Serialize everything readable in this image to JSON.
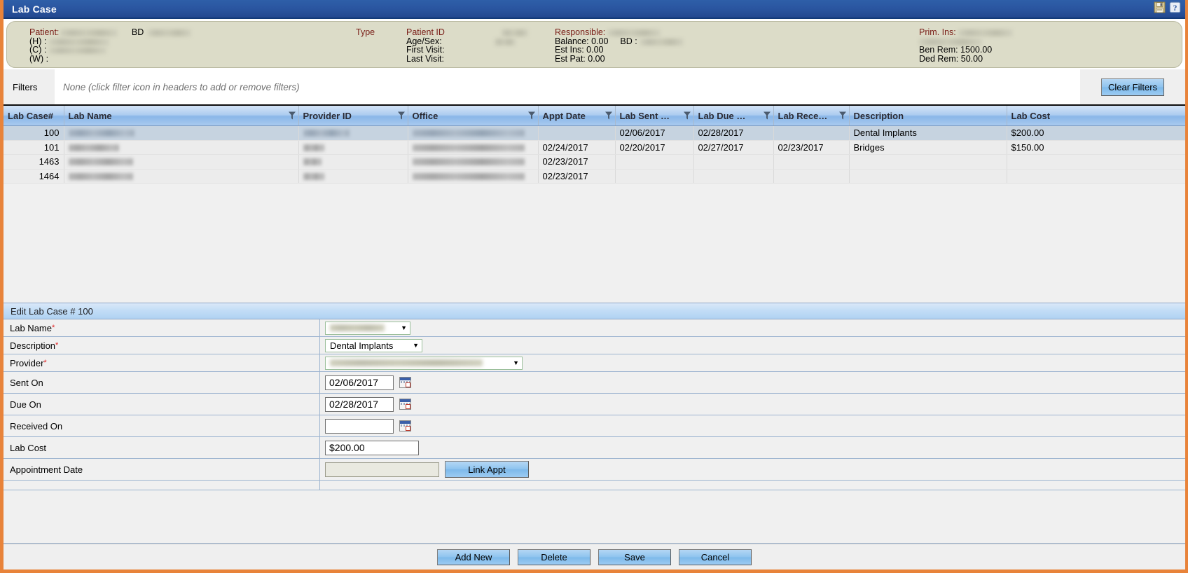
{
  "window": {
    "title": "Lab Case",
    "icons": [
      "save-disk-icon",
      "help-icon"
    ]
  },
  "patient_header": {
    "col1": {
      "patient_label": "Patient:",
      "h_label": "(H) :",
      "c_label": "(C) :",
      "w_label": "(W) :",
      "bd_label": "BD"
    },
    "col2": {
      "type_label": "Type"
    },
    "col3": {
      "patient_id_label": "Patient ID",
      "age_sex_label": "Age/Sex:",
      "first_visit_label": "First Visit:",
      "last_visit_label": "Last Visit:"
    },
    "col4": {
      "responsible_label": "Responsible:",
      "balance_label": "Balance: 0.00",
      "bd_label": "BD :",
      "est_ins_label": "Est Ins:  0.00",
      "est_pat_label": "Est Pat: 0.00"
    },
    "col5": {
      "prim_ins_label": "Prim. Ins:",
      "ben_rem_label": "Ben Rem: 1500.00",
      "ded_rem_label": "Ded Rem: 50.00"
    }
  },
  "filters": {
    "label": "Filters",
    "none_text": "None (click filter icon in headers to add or remove filters)",
    "clear_button": "Clear Filters"
  },
  "grid": {
    "columns": [
      {
        "label": "Lab Case#",
        "filter": false,
        "align": "right"
      },
      {
        "label": "Lab Name",
        "filter": true,
        "align": "left"
      },
      {
        "label": "Provider ID",
        "filter": true,
        "align": "left"
      },
      {
        "label": "Office",
        "filter": true,
        "align": "left"
      },
      {
        "label": "Appt Date",
        "filter": true,
        "align": "left"
      },
      {
        "label": "Lab Sent …",
        "filter": true,
        "align": "left"
      },
      {
        "label": "Lab Due …",
        "filter": true,
        "align": "left"
      },
      {
        "label": "Lab Rece…",
        "filter": true,
        "align": "left"
      },
      {
        "label": "Description",
        "filter": false,
        "align": "left"
      },
      {
        "label": "Lab Cost",
        "filter": false,
        "align": "left"
      }
    ],
    "rows": [
      {
        "selected": true,
        "lab_case": "100",
        "lab_name": "",
        "provider_id": "",
        "office": "",
        "appt_date": "",
        "lab_sent": "02/06/2017",
        "lab_due": "02/28/2017",
        "lab_received": "",
        "description": "Dental Implants",
        "lab_cost": "$200.00"
      },
      {
        "selected": false,
        "lab_case": "101",
        "lab_name": "",
        "provider_id": "",
        "office": "",
        "appt_date": "02/24/2017",
        "lab_sent": "02/20/2017",
        "lab_due": "02/27/2017",
        "lab_received": "02/23/2017",
        "description": "Bridges",
        "lab_cost": "$150.00"
      },
      {
        "selected": false,
        "lab_case": "1463",
        "lab_name": "",
        "provider_id": "",
        "office": "",
        "appt_date": "02/23/2017",
        "lab_sent": "",
        "lab_due": "",
        "lab_received": "",
        "description": "",
        "lab_cost": ""
      },
      {
        "selected": false,
        "lab_case": "1464",
        "lab_name": "",
        "provider_id": "",
        "office": "",
        "appt_date": "02/23/2017",
        "lab_sent": "",
        "lab_due": "",
        "lab_received": "",
        "description": "",
        "lab_cost": ""
      }
    ]
  },
  "edit_panel": {
    "header": "Edit Lab Case # 100",
    "fields": {
      "lab_name_label": "Lab Name",
      "lab_name_value": "",
      "description_label": "Description",
      "description_value": "Dental Implants",
      "provider_label": "Provider",
      "provider_value": "",
      "sent_on_label": "Sent On",
      "sent_on_value": "02/06/2017",
      "due_on_label": "Due On",
      "due_on_value": "02/28/2017",
      "received_on_label": "Received On",
      "received_on_value": "",
      "lab_cost_label": "Lab Cost",
      "lab_cost_value": "$200.00",
      "appointment_date_label": "Appointment Date",
      "appointment_date_value": "",
      "link_appt_button": "Link Appt"
    }
  },
  "footer": {
    "add_new": "Add New",
    "delete": "Delete",
    "save": "Save",
    "cancel": "Cancel"
  },
  "colors": {
    "titlebar": "#2a55a0",
    "accent_border": "#e8833a",
    "header_band": "#dcdcc8",
    "grid_header": "#8ab7e8",
    "selected_row": "#c6d3e0",
    "button_blue": "#8fc4ef",
    "required_star": "#e11d1d",
    "label_red": "#7a1f18"
  }
}
